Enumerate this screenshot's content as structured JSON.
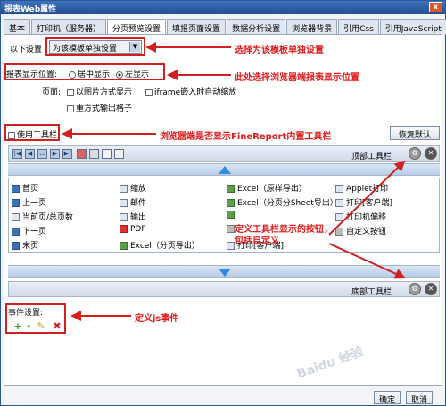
{
  "window": {
    "title": "报表Web属性",
    "close": "x"
  },
  "tabs": [
    "基本",
    "打印机（服务器）",
    "分页预览设置",
    "填报页面设置",
    "数据分析设置",
    "浏览器背景",
    "引用Css",
    "引用JavaScript"
  ],
  "settings": {
    "label": "以下设置",
    "select_value": "为该模板单独设置",
    "position_label": "报表显示位置:",
    "position_options": [
      "居中显示",
      "左显示"
    ],
    "page_label": "页面:",
    "page_options": [
      "以图片方式显示",
      "iframe嵌入时自动缩放",
      "重方式输出格子"
    ],
    "use_toolbar": "使用工具栏",
    "restore_default": "恢复默认"
  },
  "toolbar": {
    "top_label": "顶部工具栏",
    "bottom_label": "底部工具栏",
    "icons": [
      "first-icon",
      "prev-icon",
      "page-icon",
      "next-icon",
      "last-icon",
      "pdf-icon",
      "print-icon",
      "export-icon",
      "email-icon"
    ]
  },
  "items": {
    "col1": [
      "首页",
      "上一页",
      "当前页/总页数",
      "下一页",
      "末页"
    ],
    "col2": [
      "缩放",
      "邮件",
      "输出",
      "PDF",
      "Excel（分页导出）"
    ],
    "col3": [
      "Excel（原样导出）",
      "Excel（分页分Sheet导出）",
      "",
      "",
      "打印[客户端]"
    ],
    "col4": [
      "Applet打印",
      "打印[客户端]",
      "打印机偏移",
      "自定义按钮",
      ""
    ]
  },
  "events": {
    "label": "事件设置:"
  },
  "buttons": {
    "ok": "确定",
    "cancel": "取消"
  },
  "annotations": {
    "a1": "选择为该模板单独设置",
    "a2": "此处选择浏览器端报表显示位置",
    "a3": "浏览器端是否显示FineReport内置工具栏",
    "a4": "定义工具栏显示的按钮，包括自定义",
    "a5": "定义js事件"
  },
  "colors": {
    "annotation": "#e21a1a",
    "title_bar": "#2e5c9a"
  },
  "watermark": "Baidu 经验"
}
